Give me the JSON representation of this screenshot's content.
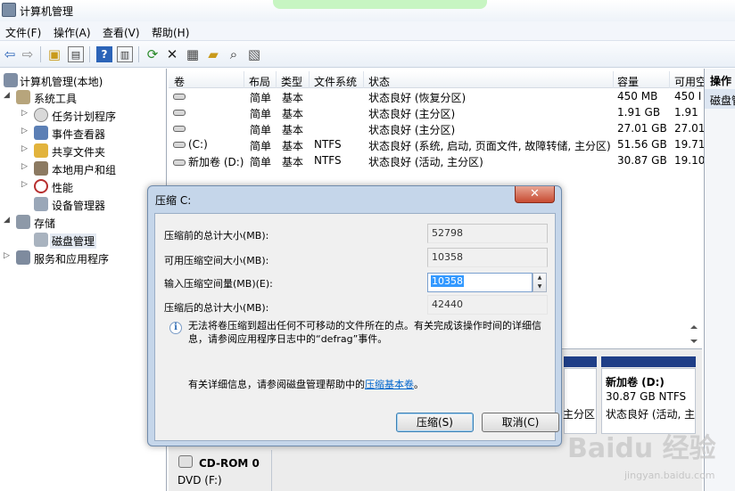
{
  "window": {
    "title": "计算机管理"
  },
  "menu": [
    "文件(F)",
    "操作(A)",
    "查看(V)",
    "帮助(H)"
  ],
  "tree": {
    "root": "计算机管理(本地)",
    "system_tools": "系统工具",
    "items": [
      "任务计划程序",
      "事件查看器",
      "共享文件夹",
      "本地用户和组",
      "性能",
      "设备管理器"
    ],
    "storage": "存储",
    "disk_management": "磁盘管理",
    "services": "服务和应用程序"
  },
  "columns": [
    "卷",
    "布局",
    "类型",
    "文件系统",
    "状态",
    "容量",
    "可用空"
  ],
  "volumes": [
    {
      "name": "",
      "layout": "简单",
      "type": "基本",
      "fs": "",
      "status": "状态良好 (恢复分区)",
      "capacity": "450 MB",
      "free": "450 I"
    },
    {
      "name": "",
      "layout": "简单",
      "type": "基本",
      "fs": "",
      "status": "状态良好 (主分区)",
      "capacity": "1.91 GB",
      "free": "1.91"
    },
    {
      "name": "",
      "layout": "简单",
      "type": "基本",
      "fs": "",
      "status": "状态良好 (主分区)",
      "capacity": "27.01 GB",
      "free": "27.01"
    },
    {
      "name": "(C:)",
      "layout": "简单",
      "type": "基本",
      "fs": "NTFS",
      "status": "状态良好 (系统, 启动, 页面文件, 故障转储, 主分区)",
      "capacity": "51.56 GB",
      "free": "19.71"
    },
    {
      "name": "新加卷 (D:)",
      "layout": "简单",
      "type": "基本",
      "fs": "NTFS",
      "status": "状态良好 (活动, 主分区)",
      "capacity": "30.87 GB",
      "free": "19.10"
    }
  ],
  "disk_view": {
    "partial_status": "主分区",
    "d_name": "新加卷  (D:)",
    "d_size": "30.87 GB NTFS",
    "d_status": "状态良好 (活动, 主",
    "cdrom_name": "CD-ROM 0",
    "cdrom_drive": "DVD (F:)"
  },
  "actions": {
    "header": "操作",
    "item": "磁盘管理"
  },
  "dialog": {
    "title": "压缩 C:",
    "close": "✕",
    "label_total_before": "压缩前的总计大小(MB):",
    "value_total_before": "52798",
    "label_available": "可用压缩空间大小(MB):",
    "value_available": "10358",
    "label_input": "输入压缩空间量(MB)(E):",
    "value_input": "10358",
    "label_total_after": "压缩后的总计大小(MB):",
    "value_total_after": "42440",
    "info": "无法将卷压缩到超出任何不可移动的文件所在的点。有关完成该操作时间的详细信息，请参阅应用程序日志中的“defrag”事件。",
    "help_prefix": "有关详细信息，请参阅磁盘管理帮助中的",
    "help_link": "压缩基本卷",
    "help_suffix": "。",
    "btn_shrink": "压缩(S)",
    "btn_cancel": "取消(C)"
  },
  "watermark": {
    "main": "Baidu 经验",
    "sub": "jingyan.baidu.com"
  }
}
